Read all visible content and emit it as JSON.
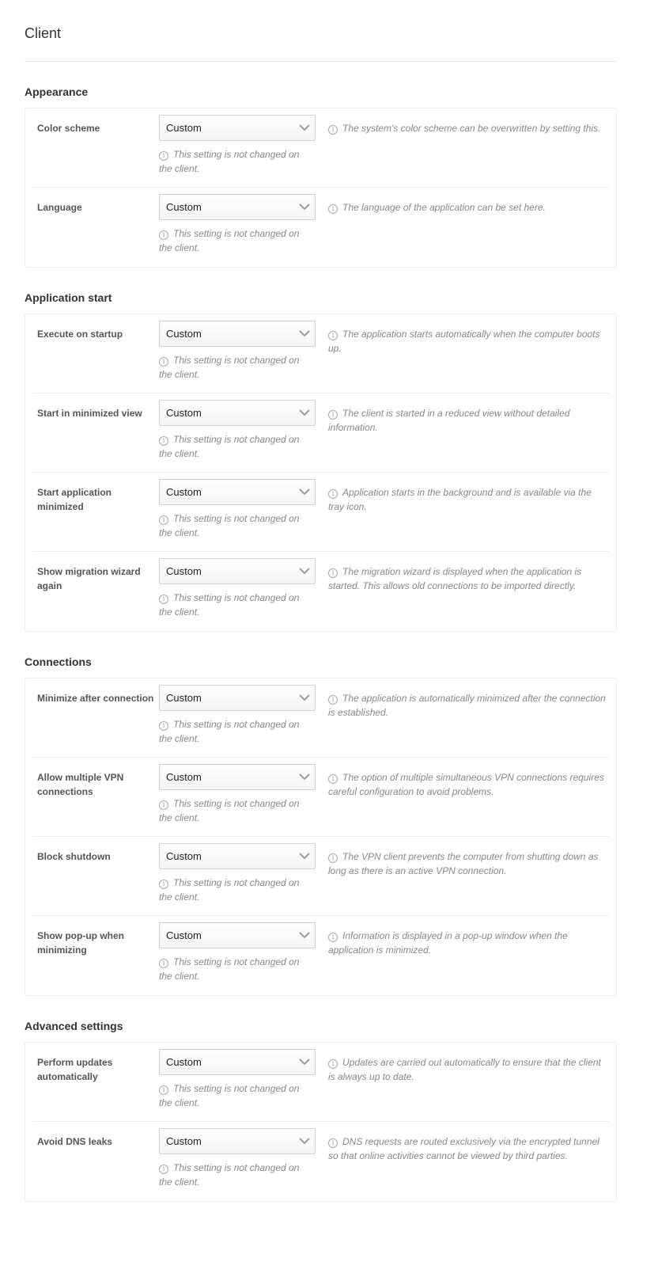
{
  "page": {
    "title": "Client"
  },
  "common": {
    "select_value": "Custom",
    "note": "This setting is not changed on the client."
  },
  "sections": [
    {
      "title": "Appearance",
      "rows": [
        {
          "label": "Color scheme",
          "value": "Custom",
          "note": "This setting is not changed on the client.",
          "description": "The system's color scheme can be overwritten by setting this."
        },
        {
          "label": "Language",
          "value": "Custom",
          "note": "This setting is not changed on the client.",
          "description": "The language of the application can be set here."
        }
      ]
    },
    {
      "title": "Application start",
      "rows": [
        {
          "label": "Execute on startup",
          "value": "Custom",
          "note": "This setting is not changed on the client.",
          "description": "The application starts automatically when the computer boots up."
        },
        {
          "label": "Start in minimized view",
          "value": "Custom",
          "note": "This setting is not changed on the client.",
          "description": "The client is started in a reduced view without detailed information."
        },
        {
          "label": "Start application minimized",
          "value": "Custom",
          "note": "This setting is not changed on the client.",
          "description": "Application starts in the background and is available via the tray icon."
        },
        {
          "label": "Show migration wizard again",
          "value": "Custom",
          "note": "This setting is not changed on the client.",
          "description": "The migration wizard is displayed when the application is started. This allows old connections to be imported directly."
        }
      ]
    },
    {
      "title": "Connections",
      "rows": [
        {
          "label": "Minimize after connection",
          "value": "Custom",
          "note": "This setting is not changed on the client.",
          "description": "The application is automatically minimized after the connection is established."
        },
        {
          "label": "Allow multiple VPN connections",
          "value": "Custom",
          "note": "This setting is not changed on the client.",
          "description": "The option of multiple simultaneous VPN connections requires careful configuration to avoid problems."
        },
        {
          "label": "Block shutdown",
          "value": "Custom",
          "note": "This setting is not changed on the client.",
          "description": "The VPN client prevents the computer from shutting down as long as there is an active VPN connection."
        },
        {
          "label": "Show pop-up when minimizing",
          "value": "Custom",
          "note": "This setting is not changed on the client.",
          "description": "Information is displayed in a pop-up window when the application is minimized."
        }
      ]
    },
    {
      "title": "Advanced settings",
      "rows": [
        {
          "label": "Perform updates automatically",
          "value": "Custom",
          "note": "This setting is not changed on the client.",
          "description": "Updates are carried out automatically to ensure that the client is always up to date."
        },
        {
          "label": "Avoid DNS leaks",
          "value": "Custom",
          "note": "This setting is not changed on the client.",
          "description": "DNS requests are routed exclusively via the encrypted tunnel so that online activities cannot be viewed by third parties."
        }
      ]
    }
  ]
}
